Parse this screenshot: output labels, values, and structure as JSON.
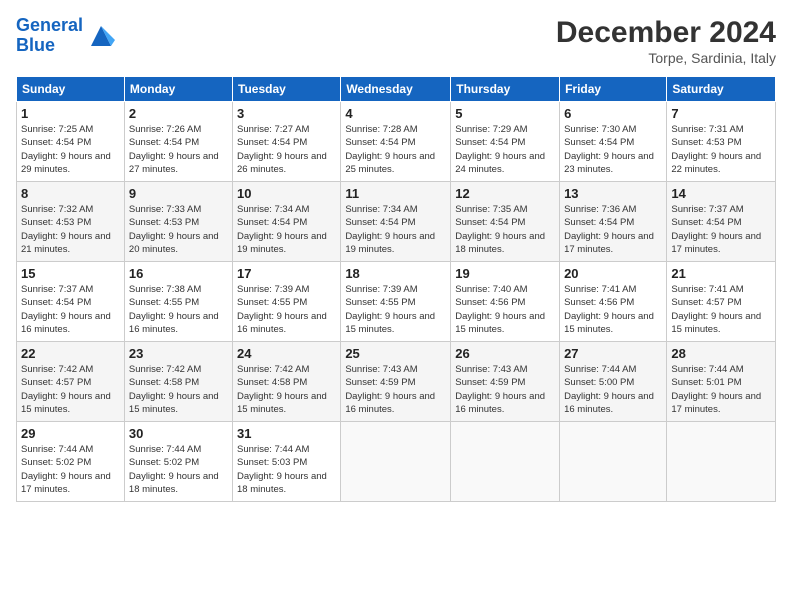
{
  "header": {
    "logo_line1": "General",
    "logo_line2": "Blue",
    "title": "December 2024",
    "subtitle": "Torpe, Sardinia, Italy"
  },
  "weekdays": [
    "Sunday",
    "Monday",
    "Tuesday",
    "Wednesday",
    "Thursday",
    "Friday",
    "Saturday"
  ],
  "weeks": [
    [
      {
        "day": "1",
        "sunrise": "Sunrise: 7:25 AM",
        "sunset": "Sunset: 4:54 PM",
        "daylight": "Daylight: 9 hours and 29 minutes."
      },
      {
        "day": "2",
        "sunrise": "Sunrise: 7:26 AM",
        "sunset": "Sunset: 4:54 PM",
        "daylight": "Daylight: 9 hours and 27 minutes."
      },
      {
        "day": "3",
        "sunrise": "Sunrise: 7:27 AM",
        "sunset": "Sunset: 4:54 PM",
        "daylight": "Daylight: 9 hours and 26 minutes."
      },
      {
        "day": "4",
        "sunrise": "Sunrise: 7:28 AM",
        "sunset": "Sunset: 4:54 PM",
        "daylight": "Daylight: 9 hours and 25 minutes."
      },
      {
        "day": "5",
        "sunrise": "Sunrise: 7:29 AM",
        "sunset": "Sunset: 4:54 PM",
        "daylight": "Daylight: 9 hours and 24 minutes."
      },
      {
        "day": "6",
        "sunrise": "Sunrise: 7:30 AM",
        "sunset": "Sunset: 4:54 PM",
        "daylight": "Daylight: 9 hours and 23 minutes."
      },
      {
        "day": "7",
        "sunrise": "Sunrise: 7:31 AM",
        "sunset": "Sunset: 4:53 PM",
        "daylight": "Daylight: 9 hours and 22 minutes."
      }
    ],
    [
      {
        "day": "8",
        "sunrise": "Sunrise: 7:32 AM",
        "sunset": "Sunset: 4:53 PM",
        "daylight": "Daylight: 9 hours and 21 minutes."
      },
      {
        "day": "9",
        "sunrise": "Sunrise: 7:33 AM",
        "sunset": "Sunset: 4:53 PM",
        "daylight": "Daylight: 9 hours and 20 minutes."
      },
      {
        "day": "10",
        "sunrise": "Sunrise: 7:34 AM",
        "sunset": "Sunset: 4:54 PM",
        "daylight": "Daylight: 9 hours and 19 minutes."
      },
      {
        "day": "11",
        "sunrise": "Sunrise: 7:34 AM",
        "sunset": "Sunset: 4:54 PM",
        "daylight": "Daylight: 9 hours and 19 minutes."
      },
      {
        "day": "12",
        "sunrise": "Sunrise: 7:35 AM",
        "sunset": "Sunset: 4:54 PM",
        "daylight": "Daylight: 9 hours and 18 minutes."
      },
      {
        "day": "13",
        "sunrise": "Sunrise: 7:36 AM",
        "sunset": "Sunset: 4:54 PM",
        "daylight": "Daylight: 9 hours and 17 minutes."
      },
      {
        "day": "14",
        "sunrise": "Sunrise: 7:37 AM",
        "sunset": "Sunset: 4:54 PM",
        "daylight": "Daylight: 9 hours and 17 minutes."
      }
    ],
    [
      {
        "day": "15",
        "sunrise": "Sunrise: 7:37 AM",
        "sunset": "Sunset: 4:54 PM",
        "daylight": "Daylight: 9 hours and 16 minutes."
      },
      {
        "day": "16",
        "sunrise": "Sunrise: 7:38 AM",
        "sunset": "Sunset: 4:55 PM",
        "daylight": "Daylight: 9 hours and 16 minutes."
      },
      {
        "day": "17",
        "sunrise": "Sunrise: 7:39 AM",
        "sunset": "Sunset: 4:55 PM",
        "daylight": "Daylight: 9 hours and 16 minutes."
      },
      {
        "day": "18",
        "sunrise": "Sunrise: 7:39 AM",
        "sunset": "Sunset: 4:55 PM",
        "daylight": "Daylight: 9 hours and 15 minutes."
      },
      {
        "day": "19",
        "sunrise": "Sunrise: 7:40 AM",
        "sunset": "Sunset: 4:56 PM",
        "daylight": "Daylight: 9 hours and 15 minutes."
      },
      {
        "day": "20",
        "sunrise": "Sunrise: 7:41 AM",
        "sunset": "Sunset: 4:56 PM",
        "daylight": "Daylight: 9 hours and 15 minutes."
      },
      {
        "day": "21",
        "sunrise": "Sunrise: 7:41 AM",
        "sunset": "Sunset: 4:57 PM",
        "daylight": "Daylight: 9 hours and 15 minutes."
      }
    ],
    [
      {
        "day": "22",
        "sunrise": "Sunrise: 7:42 AM",
        "sunset": "Sunset: 4:57 PM",
        "daylight": "Daylight: 9 hours and 15 minutes."
      },
      {
        "day": "23",
        "sunrise": "Sunrise: 7:42 AM",
        "sunset": "Sunset: 4:58 PM",
        "daylight": "Daylight: 9 hours and 15 minutes."
      },
      {
        "day": "24",
        "sunrise": "Sunrise: 7:42 AM",
        "sunset": "Sunset: 4:58 PM",
        "daylight": "Daylight: 9 hours and 15 minutes."
      },
      {
        "day": "25",
        "sunrise": "Sunrise: 7:43 AM",
        "sunset": "Sunset: 4:59 PM",
        "daylight": "Daylight: 9 hours and 16 minutes."
      },
      {
        "day": "26",
        "sunrise": "Sunrise: 7:43 AM",
        "sunset": "Sunset: 4:59 PM",
        "daylight": "Daylight: 9 hours and 16 minutes."
      },
      {
        "day": "27",
        "sunrise": "Sunrise: 7:44 AM",
        "sunset": "Sunset: 5:00 PM",
        "daylight": "Daylight: 9 hours and 16 minutes."
      },
      {
        "day": "28",
        "sunrise": "Sunrise: 7:44 AM",
        "sunset": "Sunset: 5:01 PM",
        "daylight": "Daylight: 9 hours and 17 minutes."
      }
    ],
    [
      {
        "day": "29",
        "sunrise": "Sunrise: 7:44 AM",
        "sunset": "Sunset: 5:02 PM",
        "daylight": "Daylight: 9 hours and 17 minutes."
      },
      {
        "day": "30",
        "sunrise": "Sunrise: 7:44 AM",
        "sunset": "Sunset: 5:02 PM",
        "daylight": "Daylight: 9 hours and 18 minutes."
      },
      {
        "day": "31",
        "sunrise": "Sunrise: 7:44 AM",
        "sunset": "Sunset: 5:03 PM",
        "daylight": "Daylight: 9 hours and 18 minutes."
      },
      null,
      null,
      null,
      null
    ]
  ]
}
